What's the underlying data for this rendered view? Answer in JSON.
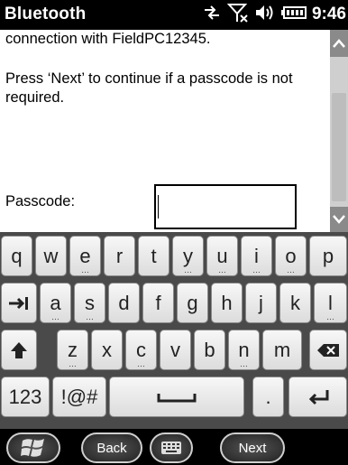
{
  "status_bar": {
    "title": "Bluetooth",
    "time": "9:46"
  },
  "content": {
    "line1": "connection with FieldPC12345.",
    "message": "Press ‘Next’ to continue if a passcode is not required.",
    "passcode_label": "Passcode:",
    "passcode_value": ""
  },
  "keyboard": {
    "row1": [
      "q",
      "w",
      "e",
      "r",
      "t",
      "y",
      "u",
      "i",
      "o",
      "p"
    ],
    "row2": [
      "a",
      "s",
      "d",
      "f",
      "g",
      "h",
      "j",
      "k",
      "l"
    ],
    "row3": [
      "z",
      "x",
      "c",
      "v",
      "b",
      "n",
      "m"
    ],
    "numbers_label": "123",
    "symbols_label": "!@#",
    "period_label": "."
  },
  "bottom_bar": {
    "back_label": "Back",
    "next_label": "Next"
  }
}
